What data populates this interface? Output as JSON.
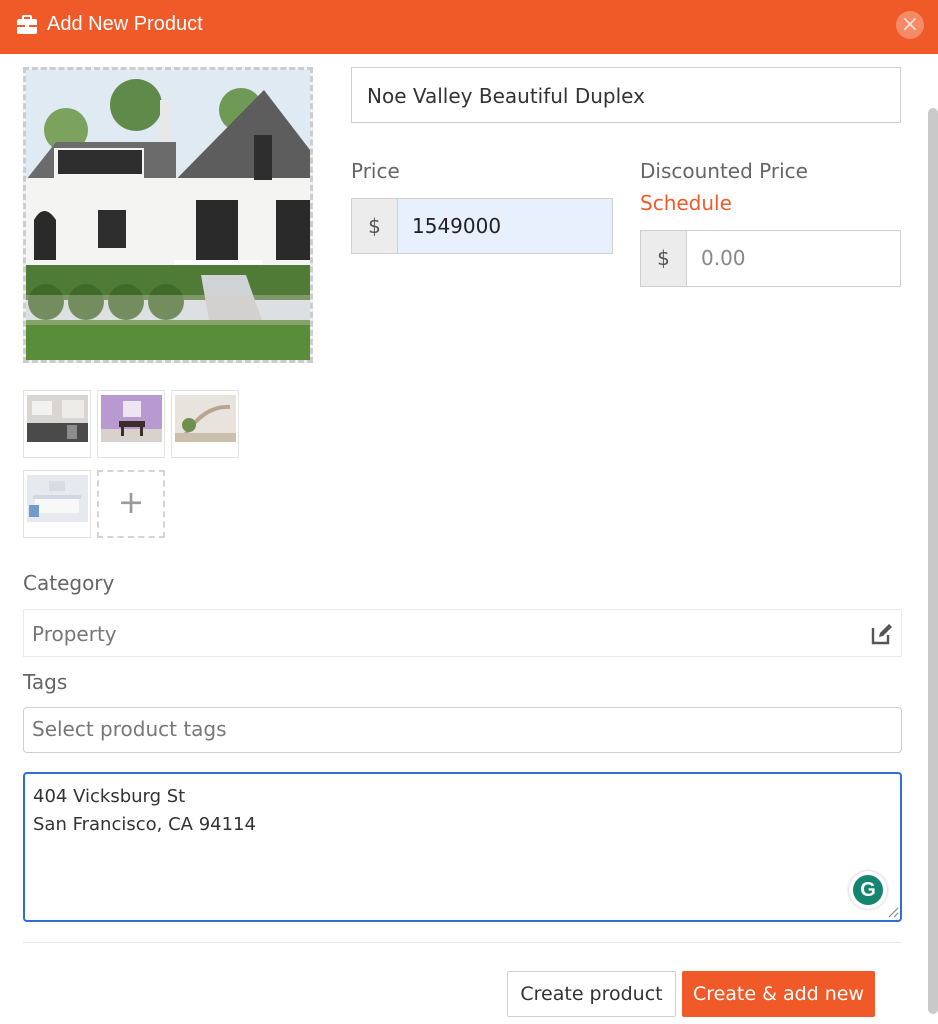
{
  "header": {
    "title": "Add New Product",
    "icon": "briefcase-icon",
    "close_icon": "close-icon",
    "accent_color": "#f05a28"
  },
  "product": {
    "name": "Noe Valley Beautiful Duplex"
  },
  "price": {
    "label": "Price",
    "currency": "$",
    "value": "1549000"
  },
  "discount": {
    "label": "Discounted Price",
    "schedule_link": "Schedule",
    "currency": "$",
    "placeholder": "0.00"
  },
  "gallery": {
    "thumbnails": [
      "kitchen",
      "dining room",
      "staircase",
      "bedroom"
    ],
    "add_symbol": "+"
  },
  "category": {
    "label": "Category",
    "value": "Property",
    "edit_icon": "edit-icon"
  },
  "tags": {
    "label": "Tags",
    "placeholder": "Select product tags"
  },
  "description": {
    "lines": [
      "404 Vicksburg St",
      "San Francisco, CA 94114"
    ]
  },
  "grammarly": {
    "letter": "G"
  },
  "actions": {
    "create": "Create product",
    "create_new": "Create & add new"
  }
}
